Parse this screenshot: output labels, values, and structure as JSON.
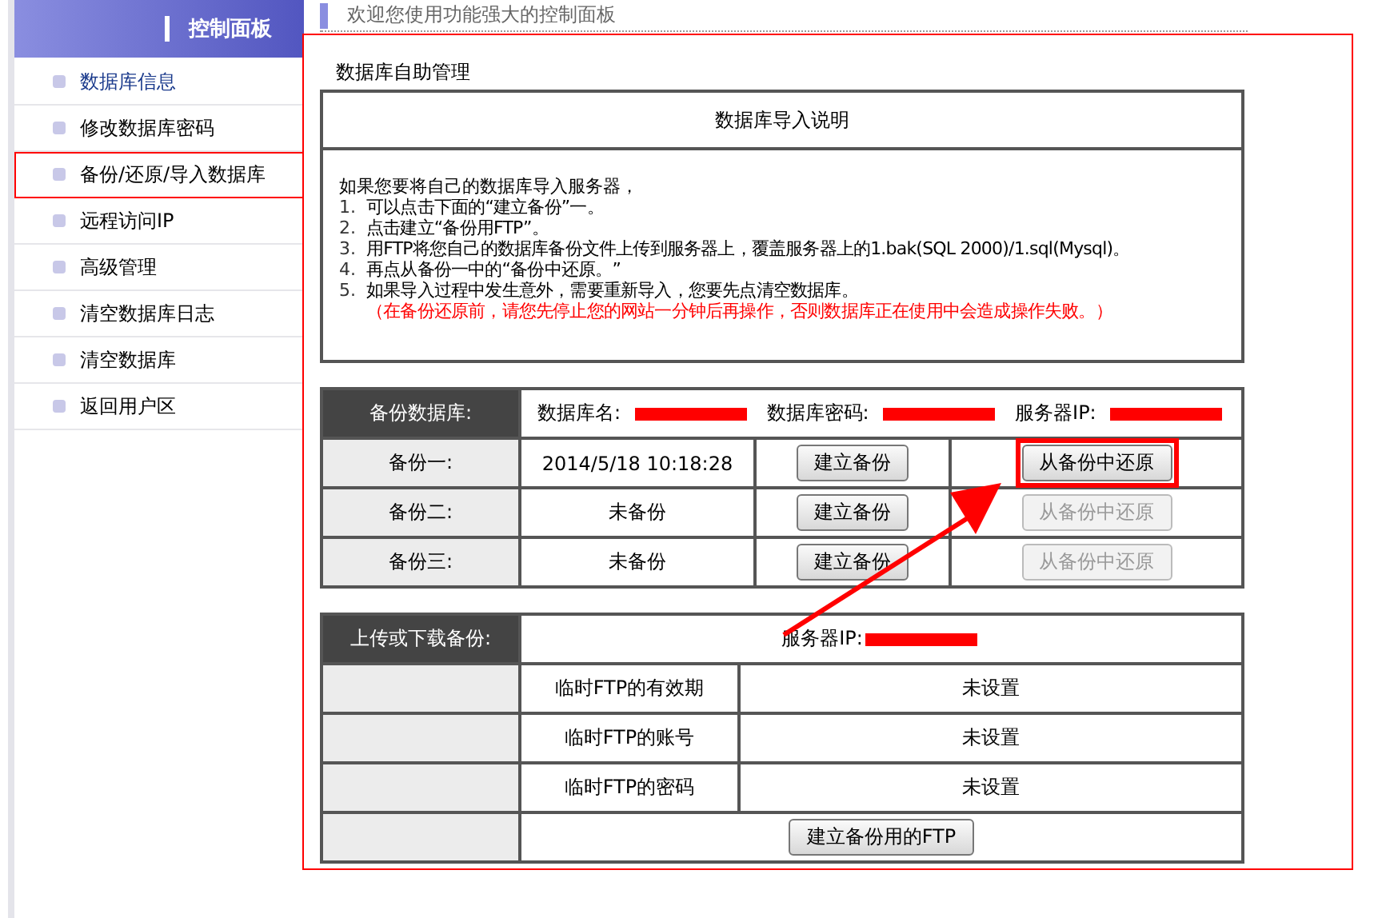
{
  "sidebar": {
    "title": "控制面板",
    "items": [
      {
        "label": "数据库信息",
        "selected": true,
        "highlighted": false
      },
      {
        "label": "修改数据库密码",
        "selected": false,
        "highlighted": false
      },
      {
        "label": "备份/还原/导入数据库",
        "selected": false,
        "highlighted": true
      },
      {
        "label": "远程访问IP",
        "selected": false,
        "highlighted": false
      },
      {
        "label": "高级管理",
        "selected": false,
        "highlighted": false
      },
      {
        "label": "清空数据库日志",
        "selected": false,
        "highlighted": false
      },
      {
        "label": "清空数据库",
        "selected": false,
        "highlighted": false
      },
      {
        "label": "返回用户区",
        "selected": false,
        "highlighted": false
      }
    ]
  },
  "header": {
    "title": "欢迎您使用功能强大的控制面板"
  },
  "main": {
    "highlighted": true,
    "title": "数据库自助管理",
    "instructions": {
      "heading": "数据库导入说明",
      "intro": "如果您要将自己的数据库导入服务器，",
      "steps": [
        {
          "number": "1.",
          "text": "可以点击下面的“建立备份”一。"
        },
        {
          "number": "2.",
          "text": "点击建立“备份用FTP”。"
        },
        {
          "number": "3.",
          "text": "用FTP将您自己的数据库备份文件上传到服务器上，覆盖服务器上的1.bak(SQL 2000)/1.sql(Mysql)。"
        },
        {
          "number": "4.",
          "text": "再点从备份一中的“备份中还原。”"
        },
        {
          "number": "5.",
          "text": "如果导入过程中发生意外，需要重新导入，您要先点清空数据库。"
        }
      ],
      "warning": "（在备份还原前，请您先停止您的网站一分钟后再操作，否则数据库正在使用中会造成操作失败。）"
    },
    "backup": {
      "label": "备份数据库:",
      "fields": [
        {
          "label": "数据库名:"
        },
        {
          "label": "数据库密码:"
        },
        {
          "label": "服务器IP:"
        }
      ],
      "rows": [
        {
          "name": "备份一:",
          "status": "2014/5/18 10:18:28",
          "create_button": "建立备份",
          "restore_button": "从备份中还原",
          "restore_disabled": false,
          "highlighted": true
        },
        {
          "name": "备份二:",
          "status": "未备份",
          "create_button": "建立备份",
          "restore_button": "从备份中还原",
          "restore_disabled": true,
          "highlighted": false
        },
        {
          "name": "备份三:",
          "status": "未备份",
          "create_button": "建立备份",
          "restore_button": "从备份中还原",
          "restore_disabled": true,
          "highlighted": false
        }
      ]
    },
    "ftp": {
      "label": "上传或下载备份:",
      "server_label": "服务器IP:",
      "rows": [
        {
          "name": "临时FTP的有效期",
          "value": "未设置"
        },
        {
          "name": "临时FTP的账号",
          "value": "未设置"
        },
        {
          "name": "临时FTP的密码",
          "value": "未设置"
        }
      ],
      "button": "建立备份用的FTP"
    },
    "arrow": true
  }
}
